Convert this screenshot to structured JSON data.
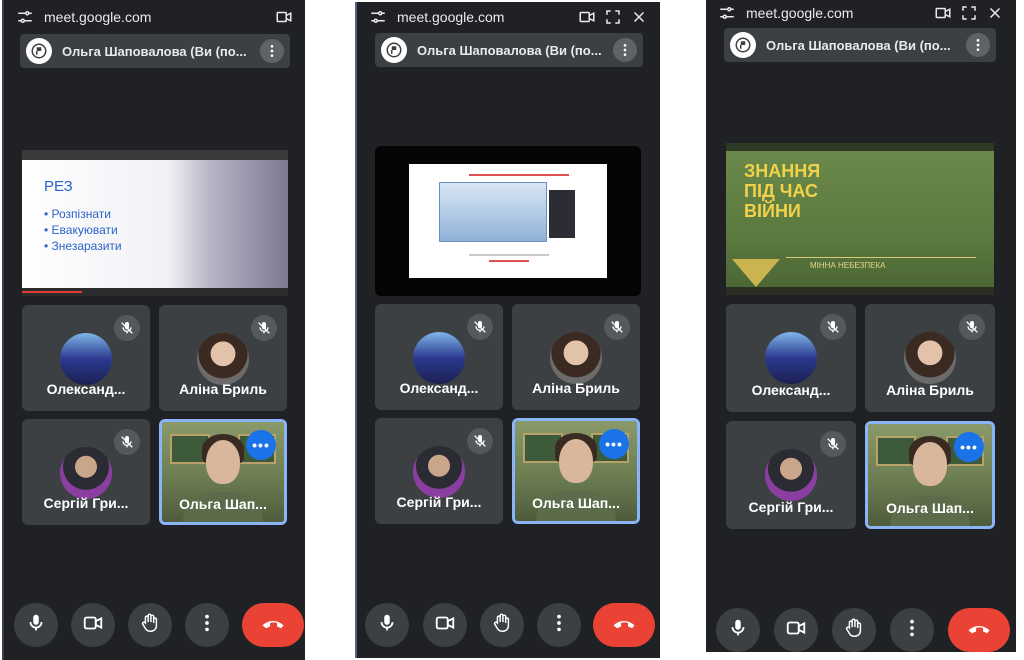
{
  "panels": [
    {
      "url": "meet.google.com",
      "title": "Ольга Шаповалова (Ви (по...",
      "share": {
        "heading": "РЕЗ",
        "bullets": [
          "• Розпізнати",
          "• Евакуювати",
          "• Знезаразити"
        ]
      },
      "participants": [
        {
          "name": "Олександ..."
        },
        {
          "name": "Аліна Бриль"
        },
        {
          "name": "Сергій Гри..."
        },
        {
          "name": "Ольга Шап..."
        }
      ]
    },
    {
      "url": "meet.google.com",
      "title": "Ольга Шаповалова (Ви (по...",
      "participants": [
        {
          "name": "Олександ..."
        },
        {
          "name": "Аліна Бриль"
        },
        {
          "name": "Сергій Гри..."
        },
        {
          "name": "Ольга Шап..."
        }
      ]
    },
    {
      "url": "meet.google.com",
      "title": "Ольга Шаповалова (Ви (по...",
      "share": {
        "heading_lines": [
          "ЗНАННЯ",
          "ПІД ЧАС",
          "ВІЙНИ"
        ],
        "subtitle": "МІННА НЕБЕЗПЕКА"
      },
      "participants": [
        {
          "name": "Олександ..."
        },
        {
          "name": "Аліна Бриль"
        },
        {
          "name": "Сергій Гри..."
        },
        {
          "name": "Ольга Шап..."
        }
      ]
    }
  ],
  "self_menu_glyph": "•••",
  "icons": {
    "tune": "tune-icon",
    "camera": "videocam-icon",
    "popout": "picture-in-picture-icon",
    "close": "close-icon",
    "more": "more-vert-icon",
    "mic_off": "mic-off-icon",
    "mic": "mic-icon",
    "hand": "raise-hand-icon",
    "hangup": "call-end-icon"
  },
  "colors": {
    "background": "#202124",
    "tile": "#3c4043",
    "accent": "#1a73e8",
    "self_border": "#8ab4f8",
    "hangup": "#ea4335"
  }
}
